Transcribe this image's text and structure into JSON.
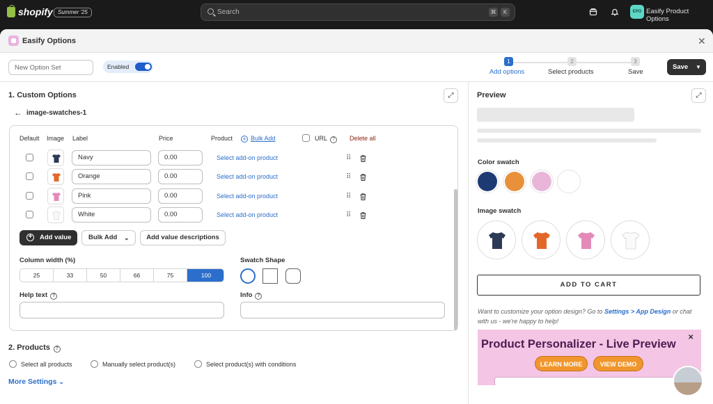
{
  "topbar": {
    "brand": "shopify",
    "edition": "Summer '25",
    "search_placeholder": "Search",
    "shortcut_keys": [
      "⌘",
      "K"
    ],
    "store_badge": "EPO",
    "store_name": "Easify Product Options"
  },
  "modal": {
    "title": "Easify Options",
    "close_icon": "close-icon"
  },
  "toolbar": {
    "option_set_placeholder": "New Option Set",
    "enabled_label": "Enabled",
    "enabled": true,
    "steps": [
      {
        "num": "1",
        "label": "Add options",
        "active": true
      },
      {
        "num": "2",
        "label": "Select products",
        "active": false
      },
      {
        "num": "3",
        "label": "Save",
        "active": false
      }
    ],
    "save_label": "Save"
  },
  "custom_options": {
    "title": "1. Custom Options",
    "option_name": "image-swatches-1",
    "headers": {
      "default": "Default",
      "image": "Image",
      "label": "Label",
      "price": "Price",
      "product": "Product",
      "bulk_add": "Bulk Add",
      "url": "URL",
      "delete_all": "Delete all"
    },
    "rows": [
      {
        "label": "Navy",
        "price": "0.00",
        "addon": "Select add-on product",
        "color": "#2c3a55"
      },
      {
        "label": "Orange",
        "price": "0.00",
        "addon": "Select add-on product",
        "color": "#e4672a"
      },
      {
        "label": "Pink",
        "price": "0.00",
        "addon": "Select add-on product",
        "color": "#e48ab8"
      },
      {
        "label": "White",
        "price": "0.00",
        "addon": "Select add-on product",
        "color": "#f7f7f7"
      }
    ],
    "add_value": "Add value",
    "bulk_add_btn": "Bulk Add",
    "add_value_descriptions": "Add value descriptions",
    "column_width_label": "Column width (%)",
    "column_widths": [
      "25",
      "33",
      "50",
      "66",
      "75",
      "100"
    ],
    "column_width_selected": "100",
    "swatch_shape_label": "Swatch Shape",
    "swatch_shapes": [
      "circle",
      "square",
      "rounded"
    ],
    "swatch_shape_selected": "circle",
    "help_text_label": "Help text",
    "info_label": "Info"
  },
  "products": {
    "title": "2. Products",
    "options": [
      "Select all products",
      "Manually select product(s)",
      "Select product(s) with conditions"
    ]
  },
  "more_settings": "More Settings",
  "preview": {
    "title": "Preview",
    "color_swatch_label": "Color swatch",
    "colors": [
      "#1e3a73",
      "#e8913a",
      "#e9b6da",
      "#ffffff"
    ],
    "image_swatch_label": "Image swatch",
    "image_colors": [
      "#2c3a55",
      "#e4672a",
      "#e48ab8",
      "#f7f7f7"
    ],
    "add_to_cart": "ADD TO CART",
    "note_prefix": "Want to customize your option design? Go to ",
    "note_link": "Settings > App Design",
    "note_suffix": " or chat with us - we're happy to help!",
    "banner_title": "Product Personalizer - Live Preview",
    "banner_learn": "LEARN MORE",
    "banner_demo": "VIEW DEMO"
  }
}
